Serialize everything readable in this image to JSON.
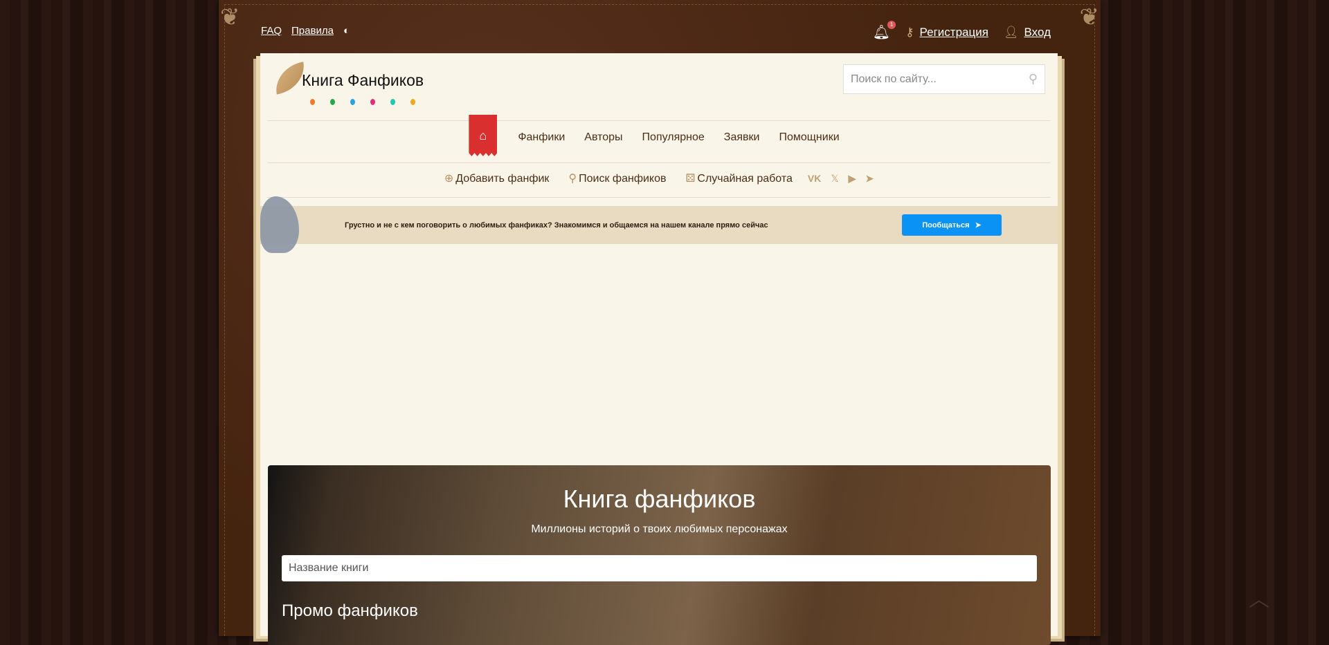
{
  "topbar": {
    "faq": "FAQ",
    "rules": "Правила",
    "notifications_count": "1",
    "register": "Регистрация",
    "login": "Вход"
  },
  "header": {
    "logo_text": "Книга Фанфиков",
    "search_placeholder": "Поиск по сайту..."
  },
  "nav": {
    "items": [
      "Фанфики",
      "Авторы",
      "Популярное",
      "Заявки",
      "Помощники"
    ]
  },
  "subnav": {
    "add": "Добавить фанфик",
    "search": "Поиск фанфиков",
    "random": "Случайная работа",
    "social": [
      "vk",
      "X",
      "youtube",
      "telegram"
    ]
  },
  "banner": {
    "text": "Грустно и не с кем поговорить о любимых фанфиках? Знакомимся и общаемся на нашем канале прямо сейчас",
    "button": "Пообщаться"
  },
  "hero": {
    "title": "Книга фанфиков",
    "subtitle": "Миллионы историй о твоих любимых персонажах",
    "input_placeholder": "Название книги",
    "promo_title": "Промо фанфиков"
  }
}
